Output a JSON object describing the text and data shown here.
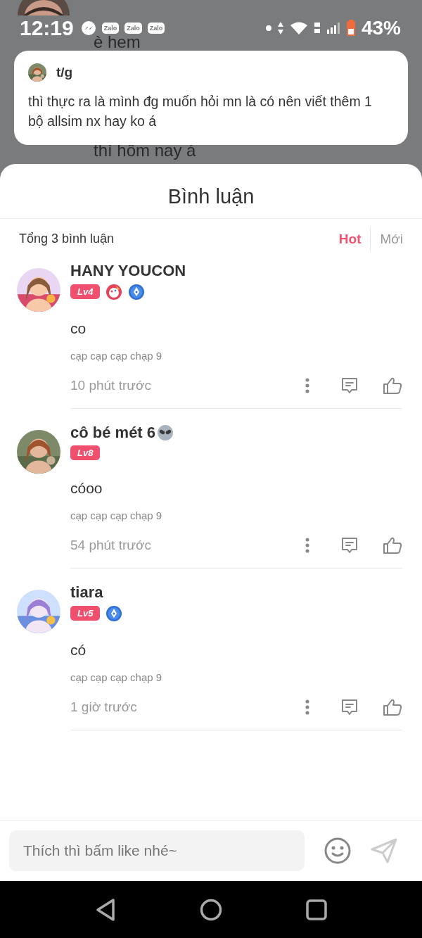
{
  "status_bar": {
    "time": "12:19",
    "notifications": [
      {
        "kind": "messenger"
      },
      {
        "kind": "zalo",
        "label": "Zalo"
      },
      {
        "kind": "zalo",
        "label": "Zalo"
      },
      {
        "kind": "zalo",
        "label": "Zalo"
      }
    ],
    "battery": "43%"
  },
  "background_chat": {
    "messages": [
      "è hem",
      "thì hôm nay á"
    ]
  },
  "quoted_message": {
    "author": "t/g",
    "text": "thì thực ra là mình đg muốn hỏi mn là có nên viết thêm 1 bộ allsim nx hay ko á"
  },
  "sheet": {
    "title": "Bình luận",
    "total": "Tổng 3 bình luận",
    "sort_tabs": [
      {
        "label": "Hot",
        "selected": true
      },
      {
        "label": "Mới",
        "selected": false
      }
    ],
    "comments": [
      {
        "name": "HANY YOUCON",
        "level": "Lv4",
        "badges": [
          {
            "kind": "palette"
          },
          {
            "kind": "pen"
          }
        ],
        "text": "co",
        "signature": "cạp cạp cạp chạp 9",
        "time": "10 phút trước"
      },
      {
        "name": "cô bé mét 6",
        "name_icons": [
          {
            "kind": "alien"
          }
        ],
        "level": "Lv8",
        "text": "cóoo",
        "signature": "cạp cạp cạp chạp 9",
        "time": "54 phút trước"
      },
      {
        "name": "tiara",
        "level": "Lv5",
        "badges": [
          {
            "kind": "pen"
          }
        ],
        "text": "có",
        "signature": "cạp cạp cạp chạp 9",
        "time": "1 giờ trước"
      }
    ],
    "input": {
      "placeholder": "Thích thì bấm like nhé~"
    }
  }
}
